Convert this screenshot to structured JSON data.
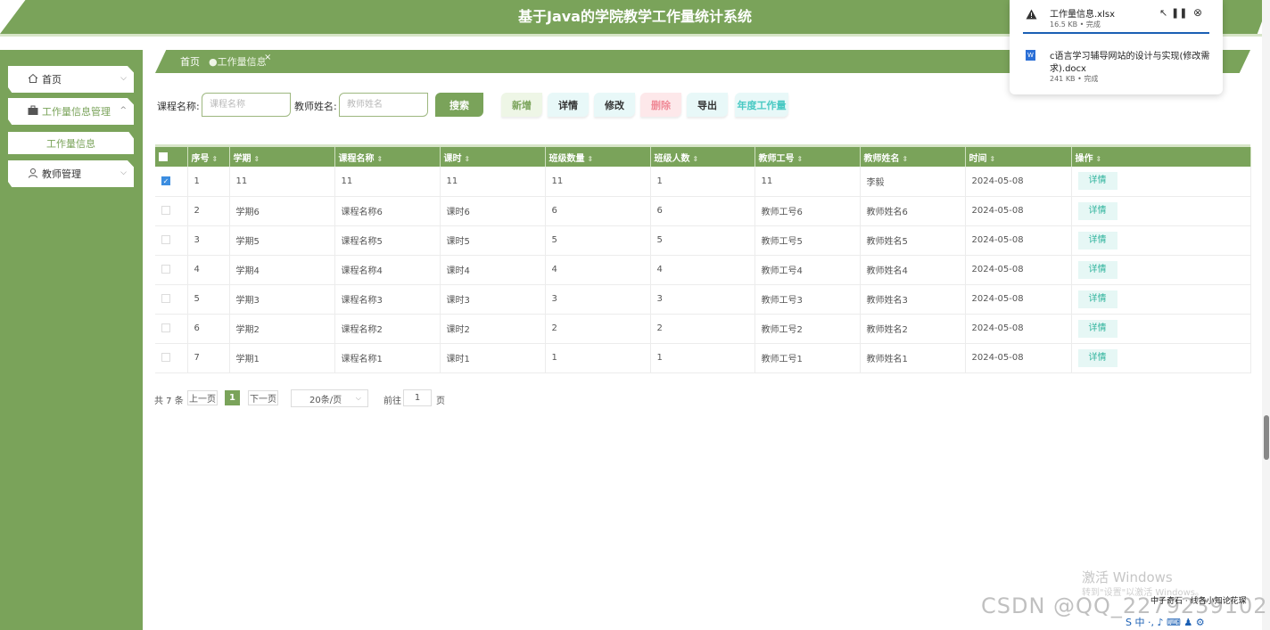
{
  "header": {
    "title": "基于Java的学院教学工作量统计系统"
  },
  "sidebar": {
    "items": [
      {
        "label": "首页"
      },
      {
        "label": "工作量信息管理"
      },
      {
        "label": "工作量信息"
      },
      {
        "label": "教师管理"
      }
    ]
  },
  "breadcrumb": {
    "home": "首页",
    "current": "●工作量信息",
    "close": "×"
  },
  "search": {
    "course_label": "课程名称:",
    "course_placeholder": "课程名称",
    "teacher_label": "教师姓名:",
    "teacher_placeholder": "教师姓名",
    "search_button": "搜索"
  },
  "toolbar": {
    "add": "新增",
    "detail": "详情",
    "edit": "修改",
    "delete": "删除",
    "export": "导出",
    "annual": "年度工作量"
  },
  "table": {
    "columns": [
      "序号",
      "学期",
      "课程名称",
      "课时",
      "班级数量",
      "班级人数",
      "教师工号",
      "教师姓名",
      "时间",
      "操作"
    ],
    "rows": [
      {
        "idx": "1",
        "term": "11",
        "course": "11",
        "hours": "11",
        "classes": "11",
        "students": "1",
        "tid": "11",
        "tname": "李毅",
        "time": "2024-05-08",
        "action": "详情",
        "checked": true
      },
      {
        "idx": "2",
        "term": "学期6",
        "course": "课程名称6",
        "hours": "课时6",
        "classes": "6",
        "students": "6",
        "tid": "教师工号6",
        "tname": "教师姓名6",
        "time": "2024-05-08",
        "action": "详情",
        "checked": false
      },
      {
        "idx": "3",
        "term": "学期5",
        "course": "课程名称5",
        "hours": "课时5",
        "classes": "5",
        "students": "5",
        "tid": "教师工号5",
        "tname": "教师姓名5",
        "time": "2024-05-08",
        "action": "详情",
        "checked": false
      },
      {
        "idx": "4",
        "term": "学期4",
        "course": "课程名称4",
        "hours": "课时4",
        "classes": "4",
        "students": "4",
        "tid": "教师工号4",
        "tname": "教师姓名4",
        "time": "2024-05-08",
        "action": "详情",
        "checked": false
      },
      {
        "idx": "5",
        "term": "学期3",
        "course": "课程名称3",
        "hours": "课时3",
        "classes": "3",
        "students": "3",
        "tid": "教师工号3",
        "tname": "教师姓名3",
        "time": "2024-05-08",
        "action": "详情",
        "checked": false
      },
      {
        "idx": "6",
        "term": "学期2",
        "course": "课程名称2",
        "hours": "课时2",
        "classes": "2",
        "students": "2",
        "tid": "教师工号2",
        "tname": "教师姓名2",
        "time": "2024-05-08",
        "action": "详情",
        "checked": false
      },
      {
        "idx": "7",
        "term": "学期1",
        "course": "课程名称1",
        "hours": "课时1",
        "classes": "1",
        "students": "1",
        "tid": "教师工号1",
        "tname": "教师姓名1",
        "time": "2024-05-08",
        "action": "详情",
        "checked": false
      }
    ]
  },
  "pagination": {
    "total": "共 7 条",
    "prev": "上一页",
    "current": "1",
    "next": "下一页",
    "page_size": "20条/页",
    "goto_label": "前往",
    "goto_value": "1",
    "page_unit": "页"
  },
  "downloads": [
    {
      "name": "工作量信息.xlsx",
      "meta": "16.5 KB • 完成"
    },
    {
      "name_line1": "c语言学习辅导网站的设计与实现(修改需",
      "name_line2": "求).docx",
      "meta": "241 KB • 完成"
    }
  ],
  "watermarks": {
    "windows": "激活 Windows",
    "windows_sub": "转到\"设置\"以激活 Windows。",
    "csdn": "CSDN @QQ_2279239102",
    "tagline": "中子奇石 · 线各小知论花琛"
  },
  "colors": {
    "primary": "#7aa35a",
    "teal": "#2eb39c",
    "checked": "#3c8de0"
  }
}
